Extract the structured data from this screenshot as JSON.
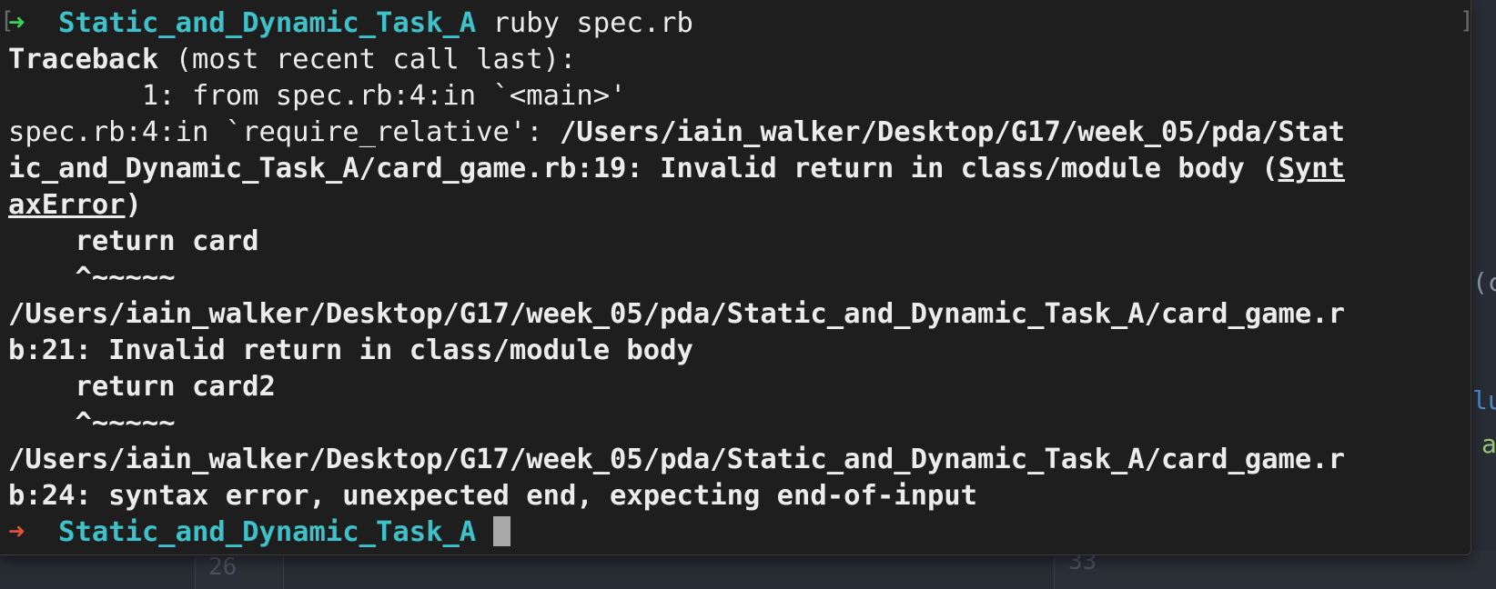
{
  "background_editor": {
    "line_number_left": "26",
    "line_number_right": "33",
    "fragments": [
      "(c",
      "lu",
      "a"
    ],
    "fragment_colors": [
      "#8b93a5",
      "#4f87c7",
      "#98c379"
    ]
  },
  "terminal": {
    "prompt_arrow": "➜",
    "prompt_dir": "Static_and_Dynamic_Task_A",
    "command": " ruby spec.rb",
    "lines": [
      "Traceback",
      " (most recent call last):",
      "        1: from spec.rb:4:in `<main>'",
      "spec.rb:4:in `require_relative': ",
      "/Users/iain_walker/Desktop/G17/week_05/pda/Stat",
      "ic_and_Dynamic_Task_A/card_game.rb:19: Invalid return in class/module body (",
      "Synt",
      "axError",
      ")",
      "    return card",
      "    ^~~~~~",
      "/Users/iain_walker/Desktop/G17/week_05/pda/Static_and_Dynamic_Task_A/card_game.r",
      "b:21: Invalid return in class/module body",
      "    return card2",
      "    ^~~~~~",
      "/Users/iain_walker/Desktop/G17/week_05/pda/Static_and_Dynamic_Task_A/card_game.r",
      "b:24: syntax error, unexpected end, expecting end-of-input"
    ],
    "final_prompt_arrow": "➜",
    "final_prompt_dir": "Static_and_Dynamic_Task_A",
    "colors": {
      "background": "#1e1e1e",
      "text": "#ececec",
      "prompt_dir": "#3fc1c9",
      "arrow_success": "#39d353",
      "arrow_error": "#e0513a",
      "cursor": "#a8a8a8"
    }
  }
}
